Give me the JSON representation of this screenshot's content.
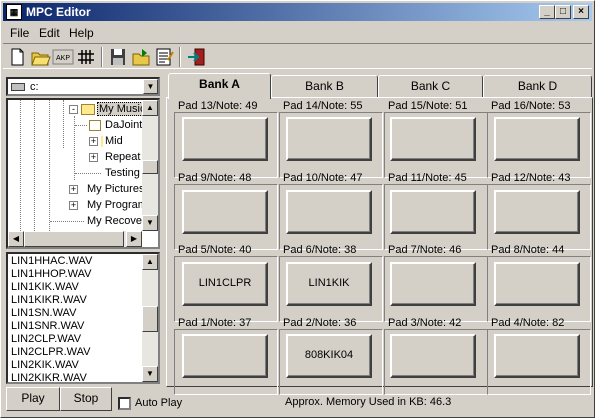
{
  "window": {
    "title": "MPC Editor"
  },
  "window_controls": [
    "_",
    "□",
    "×"
  ],
  "menu": [
    {
      "label": "File",
      "accel": "F"
    },
    {
      "label": "Edit",
      "accel": "E"
    },
    {
      "label": "Help",
      "accel": "H"
    }
  ],
  "toolbar_icons": [
    "new-document-icon",
    "open-folder-icon",
    "akp-icon",
    "pad-grid-icon",
    "save-icon",
    "export-icon",
    "notes-icon",
    "exit-icon"
  ],
  "toolbar_text": {
    "akp": "AKP",
    "grid": "####"
  },
  "drive": {
    "label": "c:"
  },
  "tree": [
    {
      "label": "My Music",
      "level": 1,
      "expander": "-",
      "selected": true
    },
    {
      "label": "DaJoint",
      "level": 2,
      "expander": ""
    },
    {
      "label": "Mid",
      "level": 2,
      "expander": "+"
    },
    {
      "label": "Repeat",
      "level": 2,
      "expander": "+"
    },
    {
      "label": "Testing",
      "level": 2,
      "expander": ""
    },
    {
      "label": "My Pictures",
      "level": 1,
      "expander": "+"
    },
    {
      "label": "My Program",
      "level": 1,
      "expander": "+"
    },
    {
      "label": "My Recove",
      "level": 1,
      "expander": ""
    }
  ],
  "files": [
    "LIN1HHAC.WAV",
    "LIN1HHOP.WAV",
    "LIN1KIK.WAV",
    "LIN1KIKR.WAV",
    "LIN1SN.WAV",
    "LIN1SNR.WAV",
    "LIN2CLP.WAV",
    "LIN2CLPR.WAV",
    "LIN2KIK.WAV",
    "LIN2KIKR.WAV"
  ],
  "buttons": {
    "play": "Play",
    "stop": "Stop"
  },
  "auto_play": {
    "label": "Auto Play",
    "checked": false
  },
  "memory_text": "Approx. Memory Used in KB: 46.3",
  "tabs": [
    {
      "label": "Bank A",
      "active": true
    },
    {
      "label": "Bank B",
      "active": false
    },
    {
      "label": "Bank C",
      "active": false
    },
    {
      "label": "Bank D",
      "active": false
    }
  ],
  "pads": [
    {
      "label": "Pad 13/Note: 49",
      "sample": ""
    },
    {
      "label": "Pad 14/Note: 55",
      "sample": ""
    },
    {
      "label": "Pad 15/Note: 51",
      "sample": ""
    },
    {
      "label": "Pad 16/Note: 53",
      "sample": ""
    },
    {
      "label": "Pad 9/Note: 48",
      "sample": ""
    },
    {
      "label": "Pad 10/Note: 47",
      "sample": ""
    },
    {
      "label": "Pad 11/Note: 45",
      "sample": ""
    },
    {
      "label": "Pad 12/Note: 43",
      "sample": ""
    },
    {
      "label": "Pad 5/Note: 40",
      "sample": "LIN1CLPR"
    },
    {
      "label": "Pad 6/Note: 38",
      "sample": "LIN1KIK"
    },
    {
      "label": "Pad 7/Note: 46",
      "sample": ""
    },
    {
      "label": "Pad 8/Note: 44",
      "sample": ""
    },
    {
      "label": "Pad 1/Note: 37",
      "sample": ""
    },
    {
      "label": "Pad 2/Note: 36",
      "sample": "808KIK04"
    },
    {
      "label": "Pad 3/Note: 42",
      "sample": ""
    },
    {
      "label": "Pad 4/Note: 82",
      "sample": ""
    }
  ]
}
